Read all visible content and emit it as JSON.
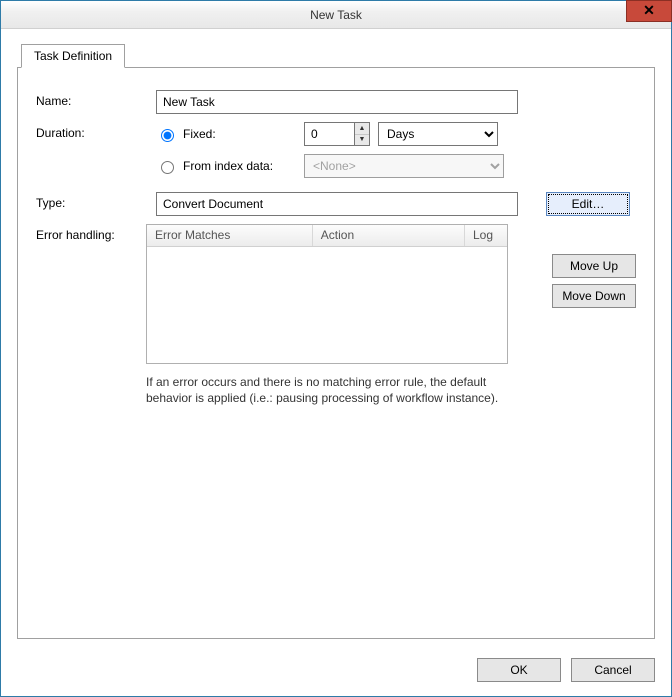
{
  "window": {
    "title": "New Task"
  },
  "tabs": {
    "definition": "Task Definition"
  },
  "labels": {
    "name": "Name:",
    "duration": "Duration:",
    "type": "Type:",
    "error_handling": "Error handling:"
  },
  "fields": {
    "name_value": "New Task",
    "duration_mode_fixed": "Fixed:",
    "duration_mode_index": "From index data:",
    "duration_value": "0",
    "duration_unit_selected": "Days",
    "duration_units": [
      "Days"
    ],
    "index_source_selected": "<None>",
    "type_value": "Convert Document"
  },
  "buttons": {
    "edit": "Edit…",
    "move_up": "Move Up",
    "move_down": "Move Down",
    "ok": "OK",
    "cancel": "Cancel",
    "close_glyph": "✕"
  },
  "error_table": {
    "columns": {
      "matches": "Error Matches",
      "action": "Action",
      "log": "Log"
    }
  },
  "help_text": "If an error occurs and there is no matching error rule, the default behavior is applied (i.e.: pausing processing of workflow instance)."
}
